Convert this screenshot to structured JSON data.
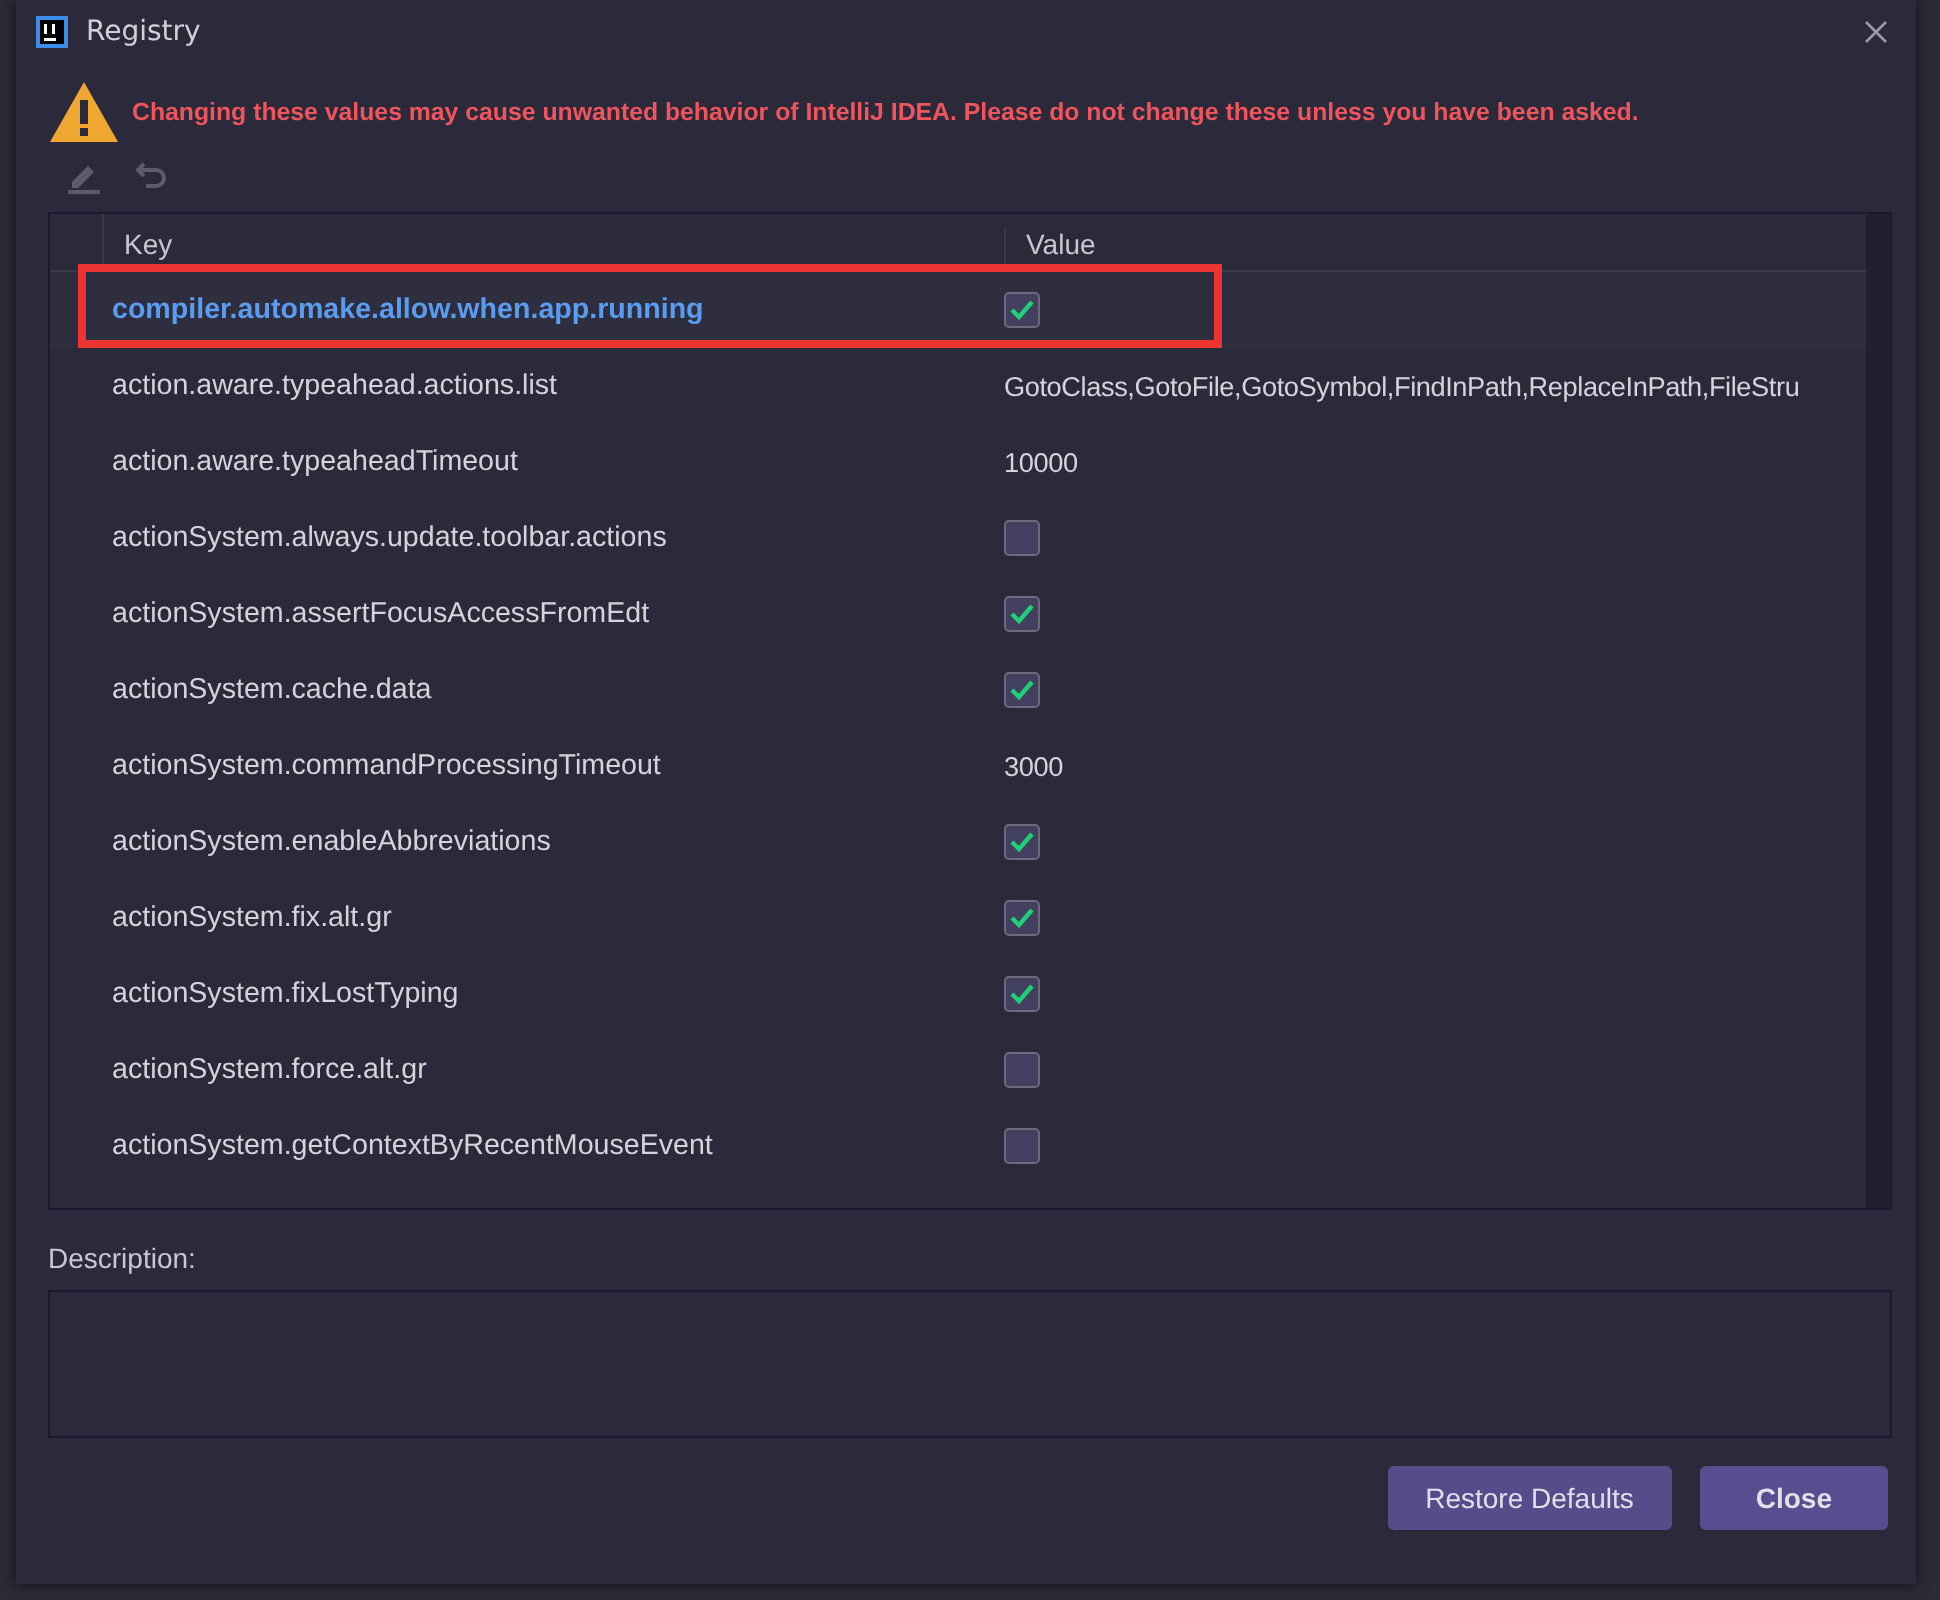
{
  "window": {
    "title": "Registry"
  },
  "warning": "Changing these values may cause unwanted behavior of IntelliJ IDEA. Please do not change these unless you have been asked.",
  "table": {
    "columns": [
      "Key",
      "Value"
    ],
    "rows": [
      {
        "key": "compiler.automake.allow.when.app.running",
        "kind": "checkbox",
        "checked": true,
        "selected": true,
        "highlighted": true
      },
      {
        "key": "action.aware.typeahead.actions.list",
        "kind": "text",
        "value": "GotoClass,GotoFile,GotoSymbol,FindInPath,ReplaceInPath,FileStru",
        "selected": false
      },
      {
        "key": "action.aware.typeaheadTimeout",
        "kind": "text",
        "value": "10000",
        "selected": false
      },
      {
        "key": "actionSystem.always.update.toolbar.actions",
        "kind": "checkbox",
        "checked": false,
        "selected": false
      },
      {
        "key": "actionSystem.assertFocusAccessFromEdt",
        "kind": "checkbox",
        "checked": true,
        "selected": false
      },
      {
        "key": "actionSystem.cache.data",
        "kind": "checkbox",
        "checked": true,
        "selected": false
      },
      {
        "key": "actionSystem.commandProcessingTimeout",
        "kind": "text",
        "value": "3000",
        "selected": false
      },
      {
        "key": "actionSystem.enableAbbreviations",
        "kind": "checkbox",
        "checked": true,
        "selected": false
      },
      {
        "key": "actionSystem.fix.alt.gr",
        "kind": "checkbox",
        "checked": true,
        "selected": false
      },
      {
        "key": "actionSystem.fixLostTyping",
        "kind": "checkbox",
        "checked": true,
        "selected": false
      },
      {
        "key": "actionSystem.force.alt.gr",
        "kind": "checkbox",
        "checked": false,
        "selected": false
      },
      {
        "key": "actionSystem.getContextByRecentMouseEvent",
        "kind": "checkbox",
        "checked": false,
        "selected": false
      }
    ]
  },
  "description": {
    "label": "Description:"
  },
  "buttons": [
    "Restore Defaults",
    "Close"
  ]
}
